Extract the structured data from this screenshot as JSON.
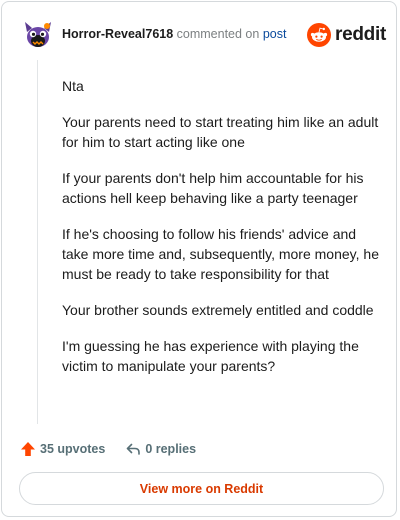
{
  "header": {
    "username": "Horror-Reveal7618",
    "commented_on": "commented on",
    "post_link": "post",
    "brand": "reddit",
    "avatar_icon": "snoo-avatar-icon",
    "logo_icon": "reddit-logo-icon"
  },
  "comment": {
    "paragraphs": [
      "Nta",
      "Your parents need to start treating him like an adult for him to start acting like one",
      "If your parents don't help him accountable for his actions hell keep behaving like a party teenager",
      "If he's choosing to follow his friends' advice and take more time and, subsequently, more money, he must be ready to take responsibility for that",
      "Your brother sounds extremely entitled and coddle",
      "I'm guessing he has experience with playing the victim to manipulate your parents?"
    ]
  },
  "actions": {
    "upvotes": "35 upvotes",
    "replies": "0 replies",
    "upvote_icon": "upvote-arrow-icon",
    "reply_icon": "reply-arrow-icon"
  },
  "footer": {
    "view_more": "View more on Reddit"
  },
  "colors": {
    "accent": "#ff4500",
    "link": "#0a4a9c",
    "view_more_text": "#d93a00",
    "muted": "#576f76"
  }
}
